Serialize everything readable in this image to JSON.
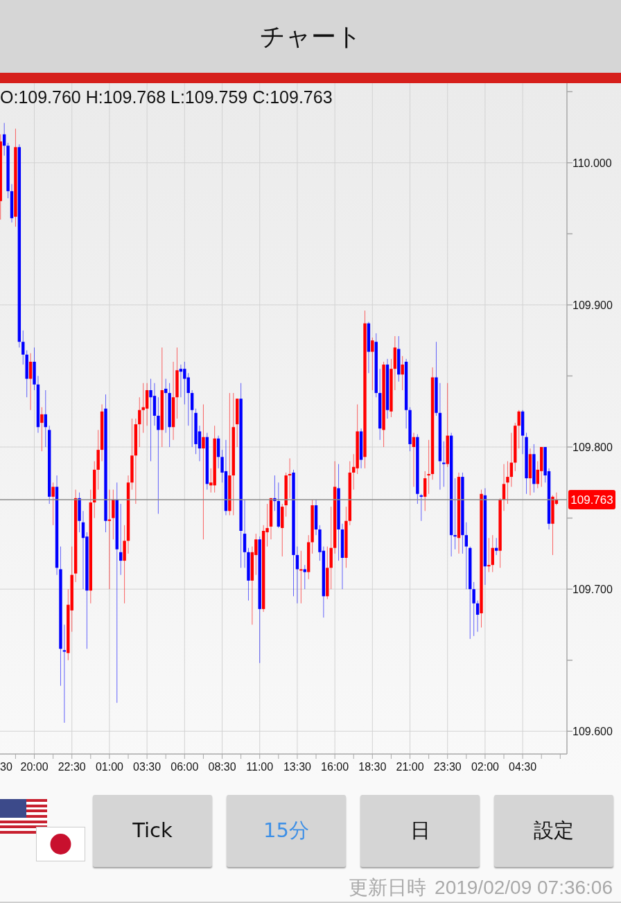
{
  "header": {
    "title": "チャート"
  },
  "chart": {
    "ohlc_readout": "O:109.760 H:109.768 L:109.759 C:109.763",
    "cut_axis_label": "30",
    "chart_data": {
      "type": "candlestick",
      "grid": true,
      "ylim": [
        109.584,
        110.056
      ],
      "categories": [
        null,
        null,
        null,
        null,
        null,
        null,
        null,
        null,
        null,
        null,
        "20:00",
        null,
        null,
        null,
        null,
        null,
        null,
        null,
        null,
        null,
        "22:30",
        null,
        null,
        null,
        null,
        null,
        null,
        null,
        null,
        null,
        "01:00",
        null,
        null,
        null,
        null,
        null,
        null,
        null,
        null,
        null,
        "03:30",
        null,
        null,
        null,
        null,
        null,
        null,
        null,
        null,
        null,
        "06:00",
        null,
        null,
        null,
        null,
        null,
        null,
        null,
        null,
        null,
        "08:30",
        null,
        null,
        null,
        null,
        null,
        null,
        null,
        null,
        null,
        "11:00",
        null,
        null,
        null,
        null,
        null,
        null,
        null,
        null,
        null,
        "13:30",
        null,
        null,
        null,
        null,
        null,
        null,
        null,
        null,
        null,
        "16:00",
        null,
        null,
        null,
        null,
        null,
        null,
        null,
        null,
        null,
        "18:30",
        null,
        null,
        null,
        null,
        null,
        null,
        null,
        null,
        null,
        "21:00",
        null,
        null,
        null,
        null,
        null,
        null,
        null,
        null,
        null,
        "23:30",
        null,
        null,
        null,
        null,
        null,
        null,
        null,
        null,
        null,
        "02:00",
        null,
        null,
        null,
        null,
        null,
        null,
        null,
        null,
        null,
        "04:30",
        null,
        null,
        null,
        null,
        null,
        null,
        null,
        null,
        null
      ],
      "yticks": [
        {
          "value": 109.6,
          "label": "109.600"
        },
        {
          "value": 109.7,
          "label": "109.700"
        },
        {
          "value": 109.8,
          "label": "109.800"
        },
        {
          "value": 109.9,
          "label": "109.900"
        },
        {
          "value": 110.0,
          "label": "110.000"
        }
      ],
      "ref_lines": [
        {
          "axis": "y",
          "value": 109.763,
          "label": "109.763"
        }
      ],
      "ohlc": [
        null,
        [
          109.973,
          110.02,
          109.96,
          110.015
        ],
        [
          110.02,
          110.028,
          110.005,
          110.012
        ],
        [
          110.012,
          110.014,
          109.975,
          109.98
        ],
        [
          109.98,
          109.985,
          109.958,
          109.961
        ],
        [
          109.962,
          110.024,
          109.955,
          110.011
        ],
        [
          110.011,
          110.013,
          109.87,
          109.874
        ],
        [
          109.874,
          109.882,
          109.858,
          109.865
        ],
        [
          109.865,
          109.868,
          109.835,
          109.848
        ],
        [
          109.848,
          109.866,
          109.826,
          109.86
        ],
        [
          109.86,
          109.87,
          109.84,
          109.844
        ],
        [
          109.844,
          109.85,
          109.81,
          109.814
        ],
        [
          109.817,
          109.828,
          109.797,
          109.823
        ],
        [
          109.823,
          109.84,
          109.8,
          109.814
        ],
        [
          109.812,
          109.815,
          109.76,
          109.765
        ],
        [
          109.765,
          109.775,
          109.745,
          109.772
        ],
        [
          109.772,
          109.78,
          109.71,
          109.715
        ],
        [
          109.714,
          109.73,
          109.632,
          109.658
        ],
        [
          109.657,
          109.675,
          109.606,
          109.656
        ],
        [
          109.655,
          109.7,
          109.65,
          109.689
        ],
        [
          109.685,
          109.73,
          109.67,
          109.71
        ],
        [
          109.711,
          109.77,
          109.705,
          109.764
        ],
        [
          109.764,
          109.768,
          109.74,
          109.748
        ],
        [
          109.747,
          109.755,
          109.7,
          109.736
        ],
        [
          109.737,
          109.74,
          109.658,
          109.699
        ],
        [
          109.699,
          109.77,
          109.69,
          109.761
        ],
        [
          109.761,
          109.79,
          109.75,
          109.784
        ],
        [
          109.784,
          109.812,
          109.77,
          109.798
        ],
        [
          109.798,
          109.83,
          109.79,
          109.825
        ],
        [
          109.827,
          109.837,
          109.74,
          109.748
        ],
        [
          109.748,
          109.77,
          109.7,
          109.749
        ],
        [
          109.75,
          109.77,
          109.735,
          109.763
        ],
        [
          109.763,
          109.775,
          109.62,
          109.728
        ],
        [
          109.726,
          109.76,
          109.71,
          109.72
        ],
        [
          109.72,
          109.745,
          109.69,
          109.734
        ],
        [
          109.734,
          109.78,
          109.725,
          109.775
        ],
        [
          109.775,
          109.82,
          109.77,
          109.794
        ],
        [
          109.794,
          109.82,
          109.76,
          109.816
        ],
        [
          109.816,
          109.835,
          109.8,
          109.826
        ],
        [
          109.826,
          109.845,
          109.81,
          109.828
        ],
        [
          109.827,
          109.845,
          109.815,
          109.84
        ],
        [
          109.84,
          109.848,
          109.79,
          109.835
        ],
        [
          109.836,
          109.845,
          109.815,
          109.822
        ],
        [
          109.822,
          109.835,
          109.753,
          109.812
        ],
        [
          109.812,
          109.87,
          109.8,
          109.84
        ],
        [
          109.841,
          109.848,
          109.81,
          109.838
        ],
        [
          109.838,
          109.845,
          109.8,
          109.814
        ],
        [
          109.814,
          109.86,
          109.805,
          109.835
        ],
        [
          109.835,
          109.87,
          109.82,
          109.854
        ],
        [
          109.855,
          109.858,
          109.835,
          109.853
        ],
        [
          109.855,
          109.86,
          109.83,
          109.848
        ],
        [
          109.849,
          109.852,
          109.815,
          109.838
        ],
        [
          109.838,
          109.84,
          109.8,
          109.826
        ],
        [
          109.824,
          109.827,
          109.795,
          109.802
        ],
        [
          109.811,
          109.815,
          109.79,
          109.799
        ],
        [
          109.799,
          109.83,
          109.735,
          109.807
        ],
        [
          109.807,
          109.81,
          109.77,
          109.774
        ],
        [
          109.773,
          109.785,
          109.768,
          109.775
        ],
        [
          109.773,
          109.815,
          109.768,
          109.806
        ],
        [
          109.806,
          109.808,
          109.785,
          109.793
        ],
        [
          109.793,
          109.798,
          109.775,
          109.782
        ],
        [
          109.783,
          109.805,
          109.752,
          109.755
        ],
        [
          109.755,
          109.838,
          109.752,
          109.78
        ],
        [
          109.78,
          109.838,
          109.752,
          109.814
        ],
        [
          109.816,
          109.834,
          109.8,
          109.834
        ],
        [
          109.834,
          109.845,
          109.715,
          109.741
        ],
        [
          109.739,
          109.763,
          109.715,
          109.726
        ],
        [
          109.726,
          109.729,
          109.692,
          109.706
        ],
        [
          109.706,
          109.73,
          109.675,
          109.726
        ],
        [
          109.724,
          109.739,
          109.71,
          109.735
        ],
        [
          109.735,
          109.737,
          109.648,
          109.686
        ],
        [
          109.686,
          109.745,
          109.684,
          109.741
        ],
        [
          109.74,
          109.76,
          109.73,
          109.743
        ],
        [
          109.744,
          109.764,
          109.735,
          109.764
        ],
        [
          109.764,
          109.78,
          109.755,
          109.762
        ],
        [
          109.762,
          109.775,
          109.743,
          109.744
        ],
        [
          109.743,
          109.76,
          109.723,
          109.758
        ],
        [
          109.759,
          109.782,
          109.751,
          109.78
        ],
        [
          109.78,
          109.792,
          109.764,
          109.781
        ],
        [
          109.782,
          109.784,
          109.695,
          109.724
        ],
        [
          109.724,
          109.73,
          109.69,
          109.714
        ],
        [
          109.714,
          109.727,
          109.69,
          109.714
        ],
        [
          109.714,
          109.717,
          109.7,
          109.712
        ],
        [
          109.712,
          109.738,
          109.707,
          109.733
        ],
        [
          109.733,
          109.763,
          109.725,
          109.759
        ],
        [
          109.759,
          109.763,
          109.738,
          109.742
        ],
        [
          109.742,
          109.745,
          109.72,
          109.726
        ],
        [
          109.727,
          109.73,
          109.68,
          109.695
        ],
        [
          109.695,
          109.73,
          109.693,
          109.715
        ],
        [
          109.715,
          109.758,
          109.7,
          109.729
        ],
        [
          109.729,
          109.79,
          109.725,
          109.772
        ],
        [
          109.771,
          109.788,
          109.72,
          109.742
        ],
        [
          109.742,
          109.746,
          109.7,
          109.722
        ],
        [
          109.722,
          109.758,
          109.715,
          109.748
        ],
        [
          109.748,
          109.79,
          109.745,
          109.782
        ],
        [
          109.782,
          109.795,
          109.77,
          109.786
        ],
        [
          109.785,
          109.83,
          109.781,
          109.811
        ],
        [
          109.811,
          109.813,
          109.785,
          109.791
        ],
        [
          109.793,
          109.896,
          109.785,
          109.887
        ],
        [
          109.887,
          109.888,
          109.852,
          109.867
        ],
        [
          109.867,
          109.877,
          109.84,
          109.875
        ],
        [
          109.874,
          109.88,
          109.835,
          109.838
        ],
        [
          109.838,
          109.855,
          109.805,
          109.813
        ],
        [
          109.812,
          109.86,
          109.8,
          109.858
        ],
        [
          109.858,
          109.862,
          109.82,
          109.826
        ],
        [
          109.825,
          109.862,
          109.821,
          109.855
        ],
        [
          109.855,
          109.878,
          109.84,
          109.87
        ],
        [
          109.869,
          109.878,
          109.846,
          109.851
        ],
        [
          109.851,
          109.864,
          109.84,
          109.858
        ],
        [
          109.86,
          109.862,
          109.813,
          109.826
        ],
        [
          109.826,
          109.828,
          109.797,
          109.802
        ],
        [
          109.8,
          109.81,
          109.772,
          109.807
        ],
        [
          109.807,
          109.809,
          109.76,
          109.767
        ],
        [
          109.766,
          109.767,
          109.748,
          109.765
        ],
        [
          109.765,
          109.783,
          109.755,
          109.778
        ],
        [
          109.78,
          109.805,
          109.767,
          109.781
        ],
        [
          109.781,
          109.856,
          109.777,
          109.849
        ],
        [
          109.849,
          109.874,
          109.822,
          109.824
        ],
        [
          109.824,
          109.845,
          109.77,
          109.79
        ],
        [
          109.789,
          109.804,
          109.772,
          109.788
        ],
        [
          109.788,
          109.845,
          109.786,
          109.808
        ],
        [
          109.808,
          109.81,
          109.723,
          109.738
        ],
        [
          109.738,
          109.778,
          109.728,
          109.737
        ],
        [
          109.736,
          109.782,
          109.725,
          109.779
        ],
        [
          109.779,
          109.782,
          109.725,
          109.738
        ],
        [
          109.738,
          109.747,
          109.7,
          109.73
        ],
        [
          109.729,
          109.73,
          109.665,
          109.7
        ],
        [
          109.7,
          109.705,
          109.667,
          109.69
        ],
        [
          109.69,
          109.692,
          109.67,
          109.682
        ],
        [
          109.683,
          109.77,
          109.673,
          109.767
        ],
        [
          109.766,
          109.771,
          109.703,
          109.716
        ],
        [
          109.716,
          109.736,
          109.712,
          109.717
        ],
        [
          109.717,
          109.738,
          109.712,
          109.729
        ],
        [
          109.729,
          109.736,
          109.724,
          109.727
        ],
        [
          109.727,
          109.764,
          109.715,
          109.763
        ],
        [
          109.763,
          109.788,
          109.755,
          109.774
        ],
        [
          109.775,
          109.79,
          109.76,
          109.779
        ],
        [
          109.779,
          109.81,
          109.772,
          109.789
        ],
        [
          109.789,
          109.817,
          109.783,
          109.815
        ],
        [
          109.815,
          109.826,
          109.799,
          109.825
        ],
        [
          109.825,
          109.826,
          109.795,
          109.808
        ],
        [
          109.807,
          109.81,
          109.767,
          109.778
        ],
        [
          109.778,
          109.799,
          109.766,
          109.795
        ],
        [
          109.795,
          109.802,
          109.768,
          109.774
        ],
        [
          109.774,
          109.79,
          109.771,
          109.784
        ],
        [
          109.783,
          109.8,
          109.772,
          109.8
        ],
        [
          109.8,
          109.8,
          109.775,
          109.78
        ],
        [
          109.783,
          109.785,
          109.742,
          109.746
        ],
        [
          109.746,
          109.766,
          109.724,
          109.765
        ],
        [
          109.76,
          109.768,
          109.759,
          109.763
        ]
      ]
    }
  },
  "buttons": [
    {
      "label": "Tick",
      "selected": false
    },
    {
      "label": "15分",
      "selected": true
    },
    {
      "label": "日",
      "selected": false
    },
    {
      "label": "設定",
      "selected": false
    }
  ],
  "updated": {
    "label": "更新日時",
    "value": "2019/02/09 07:36:06"
  }
}
